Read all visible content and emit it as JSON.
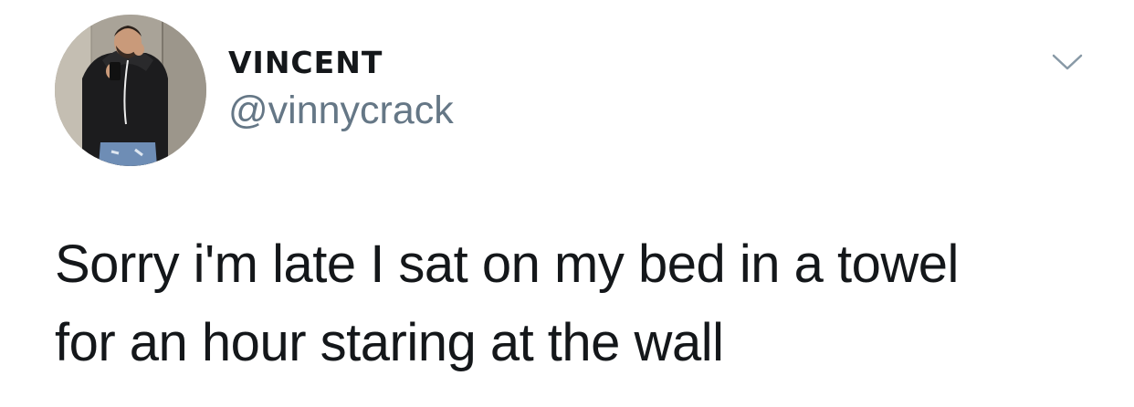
{
  "user": {
    "display_name": "VINCENT",
    "handle": "@vinnycrack"
  },
  "tweet": {
    "lines": [
      "Sorry i'm late I sat on my bed in a towel",
      "for an hour staring at the wall"
    ]
  },
  "icons": {
    "menu": "chevron-down-icon"
  },
  "colors": {
    "text": "#14171a",
    "handle": "#657786",
    "caret": "#8899a6"
  }
}
